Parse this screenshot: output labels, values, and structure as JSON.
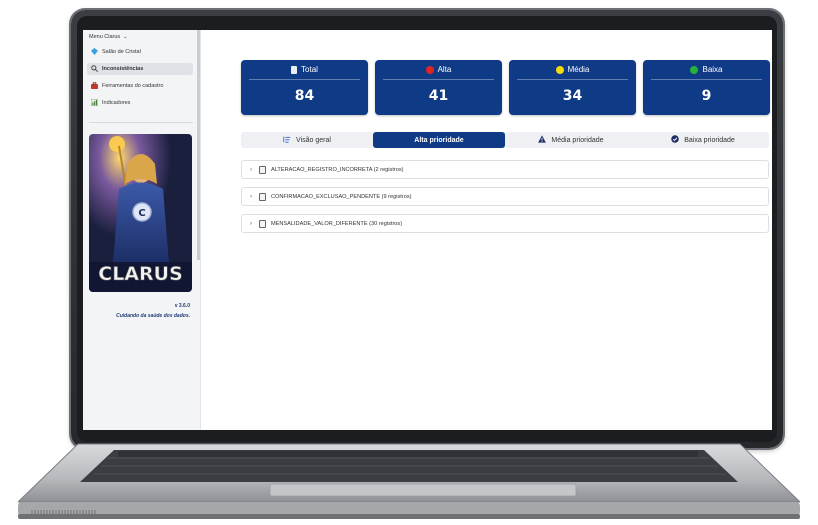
{
  "sidebar": {
    "menu_title": "Menu Clarus",
    "items": [
      {
        "label": "Salão de Cristal",
        "icon": "crystal-icon"
      },
      {
        "label": "Inconsistências",
        "icon": "search-icon",
        "active": true
      },
      {
        "label": "Ferramentas do cadastro",
        "icon": "toolbox-icon"
      },
      {
        "label": "Indicadores",
        "icon": "chart-icon"
      }
    ],
    "hero_text": "CLARUS",
    "version": "v 3.6.0",
    "tagline": "Cuidando da saúde dos dados."
  },
  "cards": [
    {
      "label": "Total",
      "value": "84",
      "icon": "clipboard-icon",
      "dot_color": null
    },
    {
      "label": "Alta",
      "value": "41",
      "icon": "red-dot-icon",
      "dot_color": "#e02424"
    },
    {
      "label": "Média",
      "value": "34",
      "icon": "yellow-dot-icon",
      "dot_color": "#f5d90a"
    },
    {
      "label": "Baixa",
      "value": "9",
      "icon": "green-dot-icon",
      "dot_color": "#26b33a"
    }
  ],
  "tabs": [
    {
      "label": "Visão geral",
      "icon": "list-icon"
    },
    {
      "label": "Alta prioridade",
      "active": true
    },
    {
      "label": "Média prioridade",
      "icon": "warning-icon"
    },
    {
      "label": "Baixa prioridade",
      "icon": "check-circle-icon"
    }
  ],
  "accordions": [
    {
      "label": "ALTERACAO_REGISTRO_INCORRETA (2 registros)"
    },
    {
      "label": "CONFIRMACAO_EXCLUSAO_PENDENTE (9 registros)"
    },
    {
      "label": "MENSALIDADE_VALOR_DIFERENTE (30 registros)"
    }
  ],
  "colors": {
    "primary": "#0f3a86",
    "sidebar_bg": "#f3f4f6"
  }
}
